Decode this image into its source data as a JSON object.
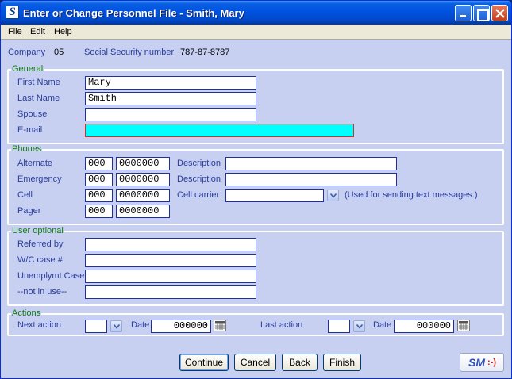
{
  "window": {
    "title": "Enter or Change Personnel File - Smith, Mary",
    "app_icon_letter": "S"
  },
  "menu": [
    "File",
    "Edit",
    "Help"
  ],
  "header": {
    "company_label": "Company",
    "company_value": "05",
    "ssn_label": "Social Security number",
    "ssn_value": "787-87-8787"
  },
  "general": {
    "title": "General",
    "first_name_label": "First Name",
    "first_name": "Mary",
    "last_name_label": "Last Name",
    "last_name": "Smith",
    "spouse_label": "Spouse",
    "spouse": "",
    "email_label": "E-mail",
    "email": ""
  },
  "phones": {
    "title": "Phones",
    "alternate_label": "Alternate",
    "alternate_area": "000",
    "alternate_number": "0000000",
    "emergency_label": "Emergency",
    "emergency_area": "000",
    "emergency_number": "0000000",
    "cell_label": "Cell",
    "cell_area": "000",
    "cell_number": "0000000",
    "pager_label": "Pager",
    "pager_area": "000",
    "pager_number": "0000000",
    "description_label": "Description",
    "alternate_description": "",
    "emergency_description": "",
    "cell_carrier_label": "Cell carrier",
    "cell_carrier": "",
    "cell_carrier_note": "(Used for sending text messages.)"
  },
  "user_optional": {
    "title": "User optional",
    "referred_by_label": "Referred by",
    "referred_by": "",
    "wc_case_label": "W/C case #",
    "wc_case": "",
    "unemplymt_label": "Unemplymt Case",
    "unemplymt": "",
    "not_in_use_label": "--not in use--",
    "not_in_use": ""
  },
  "actions": {
    "title": "Actions",
    "next_action_label": "Next action",
    "next_action": "",
    "date_label": "Date",
    "next_date": "000000",
    "last_action_label": "Last action",
    "last_action": "",
    "last_date": "000000"
  },
  "buttons": {
    "continue": "Continue",
    "cancel": "Cancel",
    "back": "Back",
    "finish": "Finish"
  },
  "logo": {
    "text": "SM",
    "smile": ":-)"
  },
  "colors": {
    "label": "#2a3c9e",
    "group_title": "#157a15",
    "email_highlight": "#00ffff"
  }
}
